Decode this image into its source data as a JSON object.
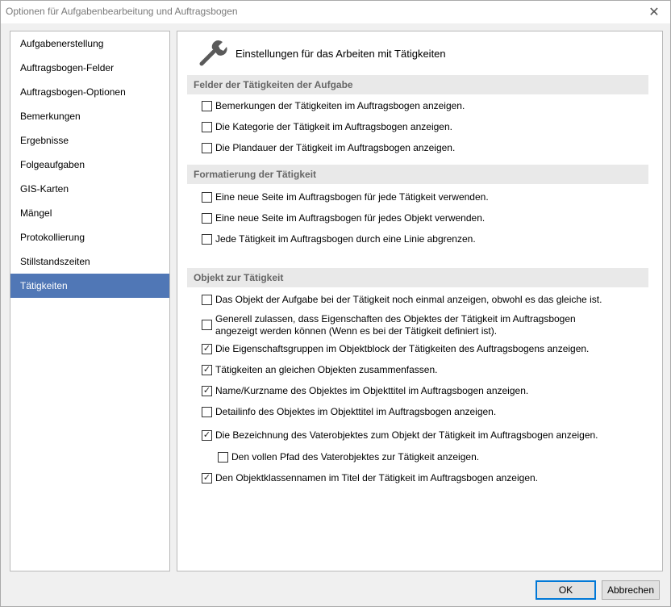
{
  "window": {
    "title": "Optionen für Aufgabenbearbeitung und Auftragsbogen",
    "close_glyph": "✕"
  },
  "sidebar": {
    "items": [
      {
        "label": "Aufgabenerstellung",
        "active": false
      },
      {
        "label": "Auftragsbogen-Felder",
        "active": false
      },
      {
        "label": "Auftragsbogen-Optionen",
        "active": false
      },
      {
        "label": "Bemerkungen",
        "active": false
      },
      {
        "label": "Ergebnisse",
        "active": false
      },
      {
        "label": "Folgeaufgaben",
        "active": false
      },
      {
        "label": "GIS-Karten",
        "active": false
      },
      {
        "label": "Mängel",
        "active": false
      },
      {
        "label": "Protokollierung",
        "active": false
      },
      {
        "label": "Stillstandszeiten",
        "active": false
      },
      {
        "label": "Tätigkeiten",
        "active": true
      }
    ],
    "active_color": "#5077b6"
  },
  "content": {
    "header_title": "Einstellungen für das Arbeiten mit Tätigkeiten",
    "header_icon": "wrench-icon",
    "sections": [
      {
        "title": "Felder der Tätigkeiten der Aufgabe",
        "options": [
          {
            "label": "Bemerkungen der Tätigkeiten im Auftragsbogen anzeigen.",
            "checked": false
          },
          {
            "label": "Die Kategorie der Tätigkeit im Auftragsbogen anzeigen.",
            "checked": false
          },
          {
            "label": "Die Plandauer der Tätigkeit im Auftragsbogen anzeigen.",
            "checked": false
          }
        ]
      },
      {
        "title": "Formatierung der Tätigkeit",
        "options": [
          {
            "label": "Eine neue Seite im Auftragsbogen für jede Tätigkeit verwenden.",
            "checked": false
          },
          {
            "label": "Eine neue Seite im Auftragsbogen für jedes Objekt verwenden.",
            "checked": false
          },
          {
            "label": "Jede Tätigkeit im Auftragsbogen durch eine Linie abgrenzen.",
            "checked": false
          }
        ]
      },
      {
        "title": "Objekt zur Tätigkeit",
        "options": [
          {
            "label": "Das Objekt der Aufgabe bei der Tätigkeit noch einmal anzeigen, obwohl es das gleiche ist.",
            "checked": false
          },
          {
            "label": "Generell zulassen, dass Eigenschaften des Objektes der Tätigkeit im Auftragsbogen angezeigt werden können (Wenn es bei der Tätigkeit definiert ist).",
            "checked": false
          },
          {
            "label": "Die Eigenschaftsgruppen im Objektblock der Tätigkeiten des Auftragsbogens anzeigen.",
            "checked": true
          },
          {
            "label": "Tätigkeiten an gleichen Objekten zusammenfassen.",
            "checked": true
          },
          {
            "label": "Name/Kurzname des Objektes im Objekttitel im Auftragsbogen anzeigen.",
            "checked": true
          },
          {
            "label": "Detailinfo des Objektes im Objekttitel im Auftragsbogen anzeigen.",
            "checked": false
          },
          {
            "label": "Die Bezeichnung des Vaterobjektes zum Objekt der Tätigkeit im Auftragsbogen anzeigen.",
            "checked": true
          },
          {
            "label": "Den vollen Pfad des Vaterobjektes zur Tätigkeit anzeigen.",
            "checked": false
          },
          {
            "label": "Den Objektklassennamen im Titel der Tätigkeit im Auftragsbogen anzeigen.",
            "checked": true
          }
        ]
      }
    ]
  },
  "buttons": {
    "ok": "OK",
    "cancel": "Abbrechen"
  },
  "check_glyph": "✓"
}
